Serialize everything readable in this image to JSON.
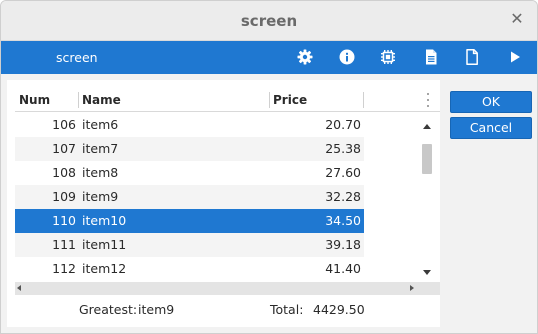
{
  "window": {
    "title": "screen"
  },
  "toolbar": {
    "title": "screen",
    "icons": [
      "gear-icon",
      "info-icon",
      "chip-icon",
      "document-icon",
      "file-icon",
      "play-icon"
    ]
  },
  "table": {
    "columns": [
      "Num",
      "Name",
      "Price"
    ],
    "selected_num": "110",
    "rows": [
      {
        "num": "106",
        "name": "item6",
        "price": "20.70"
      },
      {
        "num": "107",
        "name": "item7",
        "price": "25.38"
      },
      {
        "num": "108",
        "name": "item8",
        "price": "27.60"
      },
      {
        "num": "109",
        "name": "item9",
        "price": "32.28"
      },
      {
        "num": "110",
        "name": "item10",
        "price": "34.50"
      },
      {
        "num": "111",
        "name": "item11",
        "price": "39.18"
      },
      {
        "num": "112",
        "name": "item12",
        "price": "41.40"
      }
    ]
  },
  "footer": {
    "greatest_label": "Greatest:",
    "greatest_value": "item9",
    "total_label": "Total:",
    "total_value": "4429.50"
  },
  "buttons": {
    "ok": "OK",
    "cancel": "Cancel"
  },
  "colors": {
    "accent": "#1f78d1",
    "row_alt": "#f4f4f4"
  }
}
